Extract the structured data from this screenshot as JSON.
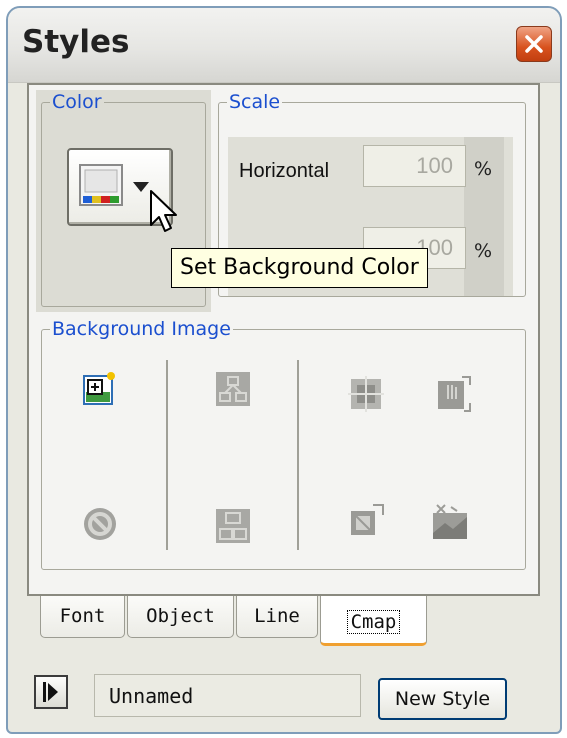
{
  "window": {
    "title": "Styles"
  },
  "color_group": {
    "legend": "Color"
  },
  "scale_group": {
    "legend": "Scale",
    "horizontal_label": "Horizontal",
    "horizontal_value": "100",
    "vertical_value": "100",
    "percent_symbol": "%"
  },
  "tooltip": {
    "text": "Set Background Color"
  },
  "background_image_group": {
    "legend": "Background Image"
  },
  "tabs": [
    {
      "label": "Font"
    },
    {
      "label": "Object"
    },
    {
      "label": "Line"
    },
    {
      "label": "Cmap",
      "active": true
    }
  ],
  "footer": {
    "style_name": "Unnamed",
    "new_style_label": "New Style"
  }
}
